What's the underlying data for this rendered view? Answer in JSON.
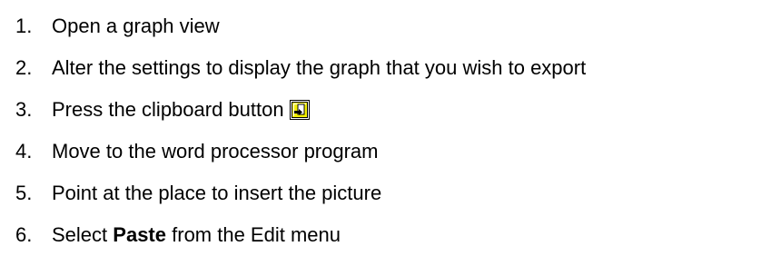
{
  "steps": [
    {
      "number": "1.",
      "text": "Open a graph view"
    },
    {
      "number": "2.",
      "text": "Alter the settings to display the graph that you wish to export"
    },
    {
      "number": "3.",
      "text": "Press the clipboard button",
      "icon": "clipboard-export-icon"
    },
    {
      "number": "4.",
      "text": "Move to the word processor program"
    },
    {
      "number": "5.",
      "text": "Point at the place to insert the picture"
    },
    {
      "number": "6.",
      "text_before": "Select",
      "text_bold": "Paste",
      "text_after": "from the Edit menu"
    }
  ],
  "colors": {
    "text": "#000000",
    "icon_yellow": "#ffee00",
    "icon_border": "#000000"
  }
}
